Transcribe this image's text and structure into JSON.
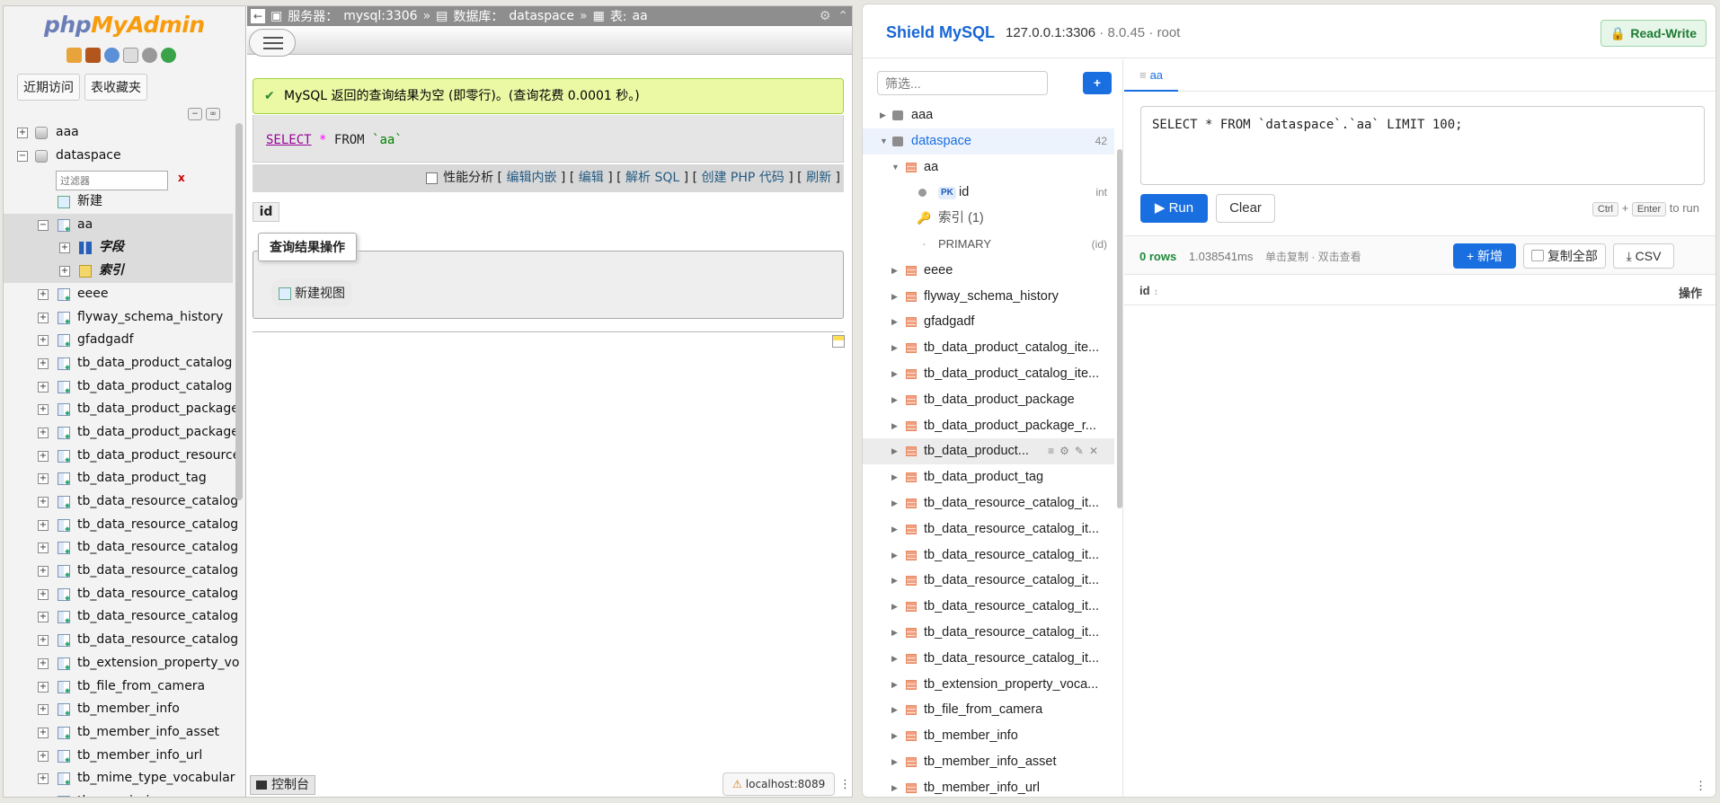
{
  "pma": {
    "logo_php": "php",
    "logo_my": "MyAdmin",
    "tab_recent": "近期访问",
    "tab_favorites": "表收藏夹",
    "tree": {
      "db1": "aaa",
      "db2": "dataspace",
      "filter_placeholder": "过滤器",
      "filter_clear": "x",
      "new_item": "新建",
      "table_aa": "aa",
      "aa_fields": "字段",
      "aa_indexes": "索引",
      "tables": [
        "eeee",
        "flyway_schema_history",
        "gfadgadf",
        "tb_data_product_catalog",
        "tb_data_product_catalog",
        "tb_data_product_package",
        "tb_data_product_package",
        "tb_data_product_resource",
        "tb_data_product_tag",
        "tb_data_resource_catalog",
        "tb_data_resource_catalog",
        "tb_data_resource_catalog",
        "tb_data_resource_catalog",
        "tb_data_resource_catalog",
        "tb_data_resource_catalog",
        "tb_data_resource_catalog",
        "tb_extension_property_vo",
        "tb_file_from_camera",
        "tb_member_info",
        "tb_member_info_asset",
        "tb_member_info_url",
        "tb_mime_type_vocabular",
        "tb_permission"
      ]
    },
    "breadcrumb": {
      "server_label": "服务器：",
      "server_value": "mysql:3306",
      "db_label": "数据库：",
      "db_value": "dataspace",
      "table_label": "表:",
      "table_value": "aa"
    },
    "success_message": "MySQL 返回的查询结果为空 (即零行)。(查询花费 0.0001 秒。)",
    "sql": {
      "select": "SELECT",
      "star": "*",
      "from": "FROM",
      "table": "`aa`"
    },
    "actions": {
      "profiling": "性能分析",
      "edit_inline": "编辑内嵌",
      "edit": "编辑",
      "explain": "解析 SQL",
      "create_php": "创建 PHP 代码",
      "refresh": "刷新"
    },
    "column_header": "id",
    "query_ops_legend": "查询结果操作",
    "new_view": "新建视图",
    "console": "控制台",
    "status_host": "localhost:8089"
  },
  "shield": {
    "title": "Shield MySQL",
    "conn_host": "127.0.0.1:3306",
    "conn_version": "8.0.45",
    "conn_user": "root",
    "rw_badge": "Read-Write",
    "filter_placeholder": "筛选...",
    "add_button": "+",
    "tree": {
      "db1": "aaa",
      "db2": "dataspace",
      "db2_count": "42",
      "table_aa": "aa",
      "pk_tag": "PK",
      "col_id": "id",
      "col_id_type": "int",
      "index_group": "索引 (1)",
      "index_primary": "PRIMARY",
      "index_primary_cols": "(id)",
      "tables": [
        "eeee",
        "flyway_schema_history",
        "gfadgadf",
        "tb_data_product_catalog_ite...",
        "tb_data_product_catalog_ite...",
        "tb_data_product_package",
        "tb_data_product_package_r...",
        "tb_data_product...",
        "tb_data_product_tag",
        "tb_data_resource_catalog_it...",
        "tb_data_resource_catalog_it...",
        "tb_data_resource_catalog_it...",
        "tb_data_resource_catalog_it...",
        "tb_data_resource_catalog_it...",
        "tb_data_resource_catalog_it...",
        "tb_data_resource_catalog_it...",
        "tb_extension_property_voca...",
        "tb_file_from_camera",
        "tb_member_info",
        "tb_member_info_asset",
        "tb_member_info_url"
      ]
    },
    "tab_label": "aa",
    "sql_text": "SELECT * FROM `dataspace`.`aa` LIMIT 100;",
    "run_label": "Run",
    "clear_label": "Clear",
    "shortcut_ctrl": "Ctrl",
    "shortcut_enter": "Enter",
    "shortcut_suffix": "to run",
    "rows_count": "0 rows",
    "elapsed": "1.038541ms",
    "hint": "单击复制 · 双击查看",
    "new_button": "+ 新增",
    "copy_all_button": "复制全部",
    "csv_button": "CSV",
    "grid_col_id": "id",
    "grid_col_ops": "操作"
  }
}
